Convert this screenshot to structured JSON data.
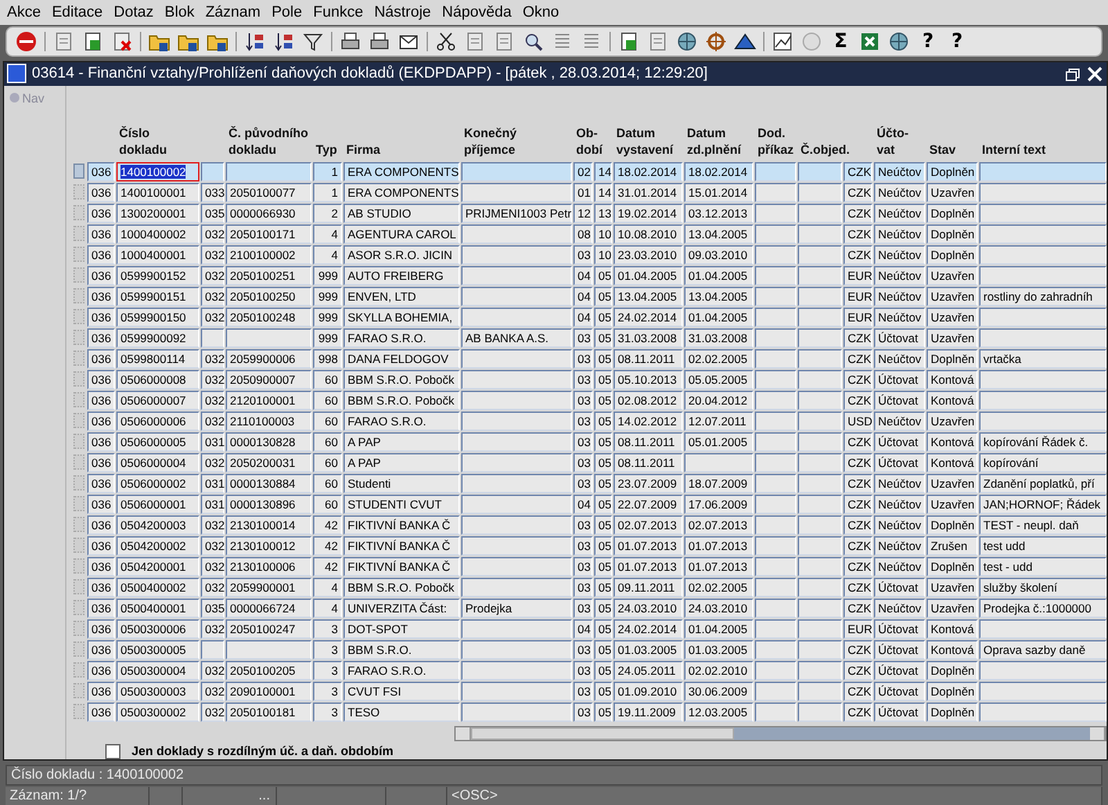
{
  "menu": [
    "Akce",
    "Editace",
    "Dotaz",
    "Blok",
    "Záznam",
    "Pole",
    "Funkce",
    "Nástroje",
    "Nápověda",
    "Okno"
  ],
  "toolbar": [
    {
      "kind": "exit"
    },
    {
      "kind": "sep"
    },
    {
      "kind": "doc-gray"
    },
    {
      "kind": "doc-green"
    },
    {
      "kind": "doc-red"
    },
    {
      "kind": "sep"
    },
    {
      "kind": "folder"
    },
    {
      "kind": "folder"
    },
    {
      "kind": "folder"
    },
    {
      "kind": "sep"
    },
    {
      "kind": "sort"
    },
    {
      "kind": "sort"
    },
    {
      "kind": "funnel"
    },
    {
      "kind": "sep"
    },
    {
      "kind": "printer"
    },
    {
      "kind": "printer"
    },
    {
      "kind": "mail"
    },
    {
      "kind": "sep"
    },
    {
      "kind": "scissors"
    },
    {
      "kind": "doc-gray"
    },
    {
      "kind": "doc-gray"
    },
    {
      "kind": "magnifier"
    },
    {
      "kind": "list"
    },
    {
      "kind": "list"
    },
    {
      "kind": "sep"
    },
    {
      "kind": "doc-green"
    },
    {
      "kind": "doc-gray"
    },
    {
      "kind": "globe"
    },
    {
      "kind": "wheel"
    },
    {
      "kind": "triangle"
    },
    {
      "kind": "sep"
    },
    {
      "kind": "chart"
    },
    {
      "kind": "circle"
    },
    {
      "kind": "glyph",
      "text": "Σ"
    },
    {
      "kind": "sheet"
    },
    {
      "kind": "globe"
    },
    {
      "kind": "glyph",
      "text": "?"
    },
    {
      "kind": "glyph",
      "text": "?"
    }
  ],
  "window": {
    "title": "03614 - Finanční vztahy/Prohlížení daňových dokladů (EKDPDAPP) - [pátek  , 28.03.2014; 12:29:20]"
  },
  "nav": {
    "label": "Nav"
  },
  "table": {
    "columns": [
      {
        "label": "Číslo\ndokladu"
      },
      {
        "label": "Č. původního\ndokladu"
      },
      {
        "label": "Typ"
      },
      {
        "label": "Firma"
      },
      {
        "label": "Konečný\npříjemce"
      },
      {
        "label": "Ob-\ndobí"
      },
      {
        "label": "Datum\nvystavení"
      },
      {
        "label": "Datum\nzd.plnění"
      },
      {
        "label": "Dod.\npříkaz"
      },
      {
        "label": "Č.objed."
      },
      {
        "label": "Účto-\nvat"
      },
      {
        "label": "Stav"
      },
      {
        "label": "Interní text"
      }
    ],
    "rows": [
      {
        "selected": true,
        "unit": "036",
        "doc_no": "1400100002",
        "type": "1",
        "company": "ERA COMPONENTS",
        "period_month": "02",
        "period_year": "14",
        "issued": "18.02.2014",
        "tax_date": "18.02.2014",
        "currency": "CZK",
        "posting": "Neúčtov",
        "status": "Doplněn"
      },
      {
        "selected": false,
        "unit": "036",
        "doc_no": "1400100001",
        "orig_series": "033",
        "orig_doc": "2050100077",
        "type": "1",
        "company": "ERA COMPONENTS",
        "period_month": "01",
        "period_year": "14",
        "issued": "31.01.2014",
        "tax_date": "15.01.2014",
        "currency": "CZK",
        "posting": "Neúčtov",
        "status": "Uzavřen"
      },
      {
        "selected": false,
        "unit": "036",
        "doc_no": "1300200001",
        "orig_series": "035",
        "orig_doc": "0000066930",
        "type": "2",
        "company": "AB STUDIO",
        "recipient": "PRIJMENI1003 Petr",
        "period_month": "12",
        "period_year": "13",
        "issued": "19.02.2014",
        "tax_date": "03.12.2013",
        "currency": "CZK",
        "posting": "Neúčtov",
        "status": "Doplněn"
      },
      {
        "selected": false,
        "unit": "036",
        "doc_no": "1000400002",
        "orig_series": "032",
        "orig_doc": "2050100171",
        "type": "4",
        "company": "AGENTURA CAROL",
        "period_month": "08",
        "period_year": "10",
        "issued": "10.08.2010",
        "tax_date": "13.04.2005",
        "currency": "CZK",
        "posting": "Neúčtov",
        "status": "Doplněn"
      },
      {
        "selected": false,
        "unit": "036",
        "doc_no": "1000400001",
        "orig_series": "032",
        "orig_doc": "2100100002",
        "type": "4",
        "company": "ASOR S.R.O. JICIN",
        "period_month": "03",
        "period_year": "10",
        "issued": "23.03.2010",
        "tax_date": "09.03.2010",
        "currency": "CZK",
        "posting": "Neúčtov",
        "status": "Doplněn"
      },
      {
        "selected": false,
        "unit": "036",
        "doc_no": "0599900152",
        "orig_series": "032",
        "orig_doc": "2050100251",
        "type": "999",
        "company": "AUTO FREIBERG",
        "period_month": "04",
        "period_year": "05",
        "issued": "01.04.2005",
        "tax_date": "01.04.2005",
        "currency": "EUR",
        "posting": "Neúčtov",
        "status": "Uzavřen"
      },
      {
        "selected": false,
        "unit": "036",
        "doc_no": "0599900151",
        "orig_series": "032",
        "orig_doc": "2050100250",
        "type": "999",
        "company": "ENVEN, LTD",
        "period_month": "04",
        "period_year": "05",
        "issued": "13.04.2005",
        "tax_date": "13.04.2005",
        "currency": "EUR",
        "posting": "Neúčtov",
        "status": "Uzavřen",
        "internal_text": "rostliny do zahradníh"
      },
      {
        "selected": false,
        "unit": "036",
        "doc_no": "0599900150",
        "orig_series": "032",
        "orig_doc": "2050100248",
        "type": "999",
        "company": "SKYLLA BOHEMIA,",
        "period_month": "04",
        "period_year": "05",
        "issued": "24.02.2014",
        "tax_date": "01.04.2005",
        "currency": "EUR",
        "posting": "Neúčtov",
        "status": "Uzavřen"
      },
      {
        "selected": false,
        "unit": "036",
        "doc_no": "0599900092",
        "type": "999",
        "company": "FARAO S.R.O.",
        "recipient": "AB BANKA A.S.",
        "period_month": "03",
        "period_year": "05",
        "issued": "31.03.2008",
        "tax_date": "31.03.2008",
        "currency": "CZK",
        "posting": "Účtovat",
        "status": "Uzavřen"
      },
      {
        "selected": false,
        "unit": "036",
        "doc_no": "0599800114",
        "orig_series": "032",
        "orig_doc": "2059900006",
        "type": "998",
        "company": "DANA FELDOGOV",
        "period_month": "03",
        "period_year": "05",
        "issued": "08.11.2011",
        "tax_date": "02.02.2005",
        "currency": "CZK",
        "posting": "Neúčtov",
        "status": "Doplněn",
        "internal_text": "vrtačka"
      },
      {
        "selected": false,
        "unit": "036",
        "doc_no": "0506000008",
        "orig_series": "032",
        "orig_doc": "2050900007",
        "type": "60",
        "company": "BBM S.R.O. Pobočk",
        "period_month": "03",
        "period_year": "05",
        "issued": "05.10.2013",
        "tax_date": "05.05.2005",
        "currency": "CZK",
        "posting": "Účtovat",
        "status": "Kontová"
      },
      {
        "selected": false,
        "unit": "036",
        "doc_no": "0506000007",
        "orig_series": "032",
        "orig_doc": "2120100001",
        "type": "60",
        "company": "BBM S.R.O. Pobočk",
        "period_month": "03",
        "period_year": "05",
        "issued": "02.08.2012",
        "tax_date": "20.04.2012",
        "currency": "CZK",
        "posting": "Účtovat",
        "status": "Kontová"
      },
      {
        "selected": false,
        "unit": "036",
        "doc_no": "0506000006",
        "orig_series": "032",
        "orig_doc": "2110100003",
        "type": "60",
        "company": "FARAO S.R.O.",
        "period_month": "03",
        "period_year": "05",
        "issued": "14.02.2012",
        "tax_date": "12.07.2011",
        "currency": "USD",
        "posting": "Neúčtov",
        "status": "Uzavřen"
      },
      {
        "selected": false,
        "unit": "036",
        "doc_no": "0506000005",
        "orig_series": "031",
        "orig_doc": "0000130828",
        "type": "60",
        "company": "A PAP",
        "period_month": "03",
        "period_year": "05",
        "issued": "08.11.2011",
        "tax_date": "05.01.2005",
        "currency": "CZK",
        "posting": "Účtovat",
        "status": "Kontová",
        "internal_text": "kopírování Řádek č."
      },
      {
        "selected": false,
        "unit": "036",
        "doc_no": "0506000004",
        "orig_series": "032",
        "orig_doc": "2050200031",
        "type": "60",
        "company": "A PAP",
        "period_month": "03",
        "period_year": "05",
        "issued": "08.11.2011",
        "currency": "CZK",
        "posting": "Účtovat",
        "status": "Kontová",
        "internal_text": "kopírování"
      },
      {
        "selected": false,
        "unit": "036",
        "doc_no": "0506000002",
        "orig_series": "031",
        "orig_doc": "0000130884",
        "type": "60",
        "company": "Studenti",
        "period_month": "03",
        "period_year": "05",
        "issued": "23.07.2009",
        "tax_date": "18.07.2009",
        "currency": "CZK",
        "posting": "Neúčtov",
        "status": "Uzavřen",
        "internal_text": "Zdanění poplatků, pří"
      },
      {
        "selected": false,
        "unit": "036",
        "doc_no": "0506000001",
        "orig_series": "031",
        "orig_doc": "0000130896",
        "type": "60",
        "company": "STUDENTI CVUT",
        "period_month": "04",
        "period_year": "05",
        "issued": "22.07.2009",
        "tax_date": "17.06.2009",
        "currency": "CZK",
        "posting": "Neúčtov",
        "status": "Uzavřen",
        "internal_text": "JAN;HORNOF; Řádek"
      },
      {
        "selected": false,
        "unit": "036",
        "doc_no": "0504200003",
        "orig_series": "032",
        "orig_doc": "2130100014",
        "type": "42",
        "company": "FIKTIVNÍ BANKA Č",
        "period_month": "03",
        "period_year": "05",
        "issued": "02.07.2013",
        "tax_date": "02.07.2013",
        "currency": "CZK",
        "posting": "Neúčtov",
        "status": "Doplněn",
        "internal_text": "TEST - neupl. daň"
      },
      {
        "selected": false,
        "unit": "036",
        "doc_no": "0504200002",
        "orig_series": "032",
        "orig_doc": "2130100012",
        "type": "42",
        "company": "FIKTIVNÍ BANKA Č",
        "period_month": "03",
        "period_year": "05",
        "issued": "01.07.2013",
        "tax_date": "01.07.2013",
        "currency": "CZK",
        "posting": "Neúčtov",
        "status": "Zrušen",
        "internal_text": "test udd"
      },
      {
        "selected": false,
        "unit": "036",
        "doc_no": "0504200001",
        "orig_series": "032",
        "orig_doc": "2130100006",
        "type": "42",
        "company": "FIKTIVNÍ BANKA Č",
        "period_month": "03",
        "period_year": "05",
        "issued": "01.07.2013",
        "tax_date": "01.07.2013",
        "currency": "CZK",
        "posting": "Neúčtov",
        "status": "Doplněn",
        "internal_text": "test - udd"
      },
      {
        "selected": false,
        "unit": "036",
        "doc_no": "0500400002",
        "orig_series": "032",
        "orig_doc": "2059900001",
        "type": "4",
        "company": "BBM S.R.O. Pobočk",
        "period_month": "03",
        "period_year": "05",
        "issued": "09.11.2011",
        "tax_date": "02.02.2005",
        "currency": "CZK",
        "posting": "Účtovat",
        "status": "Uzavřen",
        "internal_text": "služby školení"
      },
      {
        "selected": false,
        "unit": "036",
        "doc_no": "0500400001",
        "orig_series": "035",
        "orig_doc": "0000066724",
        "type": "4",
        "company": "UNIVERZITA Část:",
        "recipient": "Prodejka",
        "period_month": "03",
        "period_year": "05",
        "issued": "24.03.2010",
        "tax_date": "24.03.2010",
        "currency": "CZK",
        "posting": "Neúčtov",
        "status": "Uzavřen",
        "internal_text": "Prodejka č.:1000000"
      },
      {
        "selected": false,
        "unit": "036",
        "doc_no": "0500300006",
        "orig_series": "032",
        "orig_doc": "2050100247",
        "type": "3",
        "company": "DOT-SPOT",
        "period_month": "04",
        "period_year": "05",
        "issued": "24.02.2014",
        "tax_date": "01.04.2005",
        "currency": "EUR",
        "posting": "Účtovat",
        "status": "Kontová"
      },
      {
        "selected": false,
        "unit": "036",
        "doc_no": "0500300005",
        "type": "3",
        "company": "BBM S.R.O.",
        "period_month": "03",
        "period_year": "05",
        "issued": "01.03.2005",
        "tax_date": "01.03.2005",
        "currency": "CZK",
        "posting": "Účtovat",
        "status": "Kontová",
        "internal_text": "Oprava sazby daně"
      },
      {
        "selected": false,
        "unit": "036",
        "doc_no": "0500300004",
        "orig_series": "032",
        "orig_doc": "2050100205",
        "type": "3",
        "company": "FARAO S.R.O.",
        "period_month": "03",
        "period_year": "05",
        "issued": "24.05.2011",
        "tax_date": "02.02.2010",
        "currency": "CZK",
        "posting": "Účtovat",
        "status": "Doplněn"
      },
      {
        "selected": false,
        "unit": "036",
        "doc_no": "0500300003",
        "orig_series": "032",
        "orig_doc": "2090100001",
        "type": "3",
        "company": "CVUT FSI",
        "period_month": "03",
        "period_year": "05",
        "issued": "01.09.2010",
        "tax_date": "30.06.2009",
        "currency": "CZK",
        "posting": "Účtovat",
        "status": "Doplněn"
      },
      {
        "selected": false,
        "unit": "036",
        "doc_no": "0500300002",
        "orig_series": "032",
        "orig_doc": "2050100181",
        "type": "3",
        "company": "TESO",
        "period_month": "03",
        "period_year": "05",
        "issued": "19.11.2009",
        "tax_date": "12.03.2005",
        "currency": "CZK",
        "posting": "Účtovat",
        "status": "Doplněn"
      }
    ]
  },
  "filter_checkbox": {
    "label": "Jen doklady s rozdílným úč. a daň. obdobím",
    "checked": false
  },
  "status_bar": {
    "message": "Číslo dokladu : 1400100002",
    "record": "Záznam: 1/?",
    "field_3": "...",
    "mode": "<OSC>"
  }
}
